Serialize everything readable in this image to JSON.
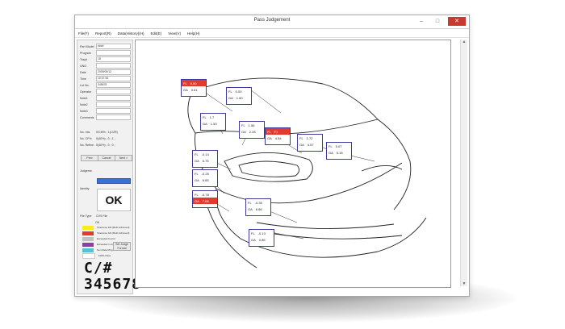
{
  "window": {
    "title": "Pass Judgement",
    "controls": {
      "minimize": "–",
      "maximize": "□",
      "close": "✕"
    }
  },
  "menu": [
    "File(F)",
    "Report(R)",
    "Data(History)(H)",
    "Edit(E)",
    "View(V)",
    "Help(H)"
  ],
  "fields": [
    {
      "label": "Part Model",
      "value": "####"
    },
    {
      "label": "Program",
      "value": ""
    },
    {
      "label": "Tray#",
      "value": "18"
    },
    {
      "label": "UNO",
      "value": ""
    },
    {
      "label": "Date",
      "value": "2009/05/12"
    },
    {
      "label": "Time",
      "value": "10:07:45"
    },
    {
      "label": "Lot No.",
      "value": "345678"
    },
    {
      "label": "Operator",
      "value": ""
    },
    {
      "label": "Note1",
      "value": ""
    },
    {
      "label": "Note2",
      "value": ""
    },
    {
      "label": "Note3",
      "value": ""
    },
    {
      "label": "Comments",
      "value": ""
    }
  ],
  "stats": [
    {
      "label": "No. mis.",
      "value": "0/CM% ; 1(L/2R)"
    },
    {
      "label": "No. CF%",
      "value": "0(40%) ; 0 ; 1 ;"
    },
    {
      "label": "No. Refine.",
      "value": "0(40%) ; 0 ; 0 ;"
    }
  ],
  "nav_buttons": {
    "prev": "Prev",
    "cancel": "Cancel",
    "next": "Next >"
  },
  "judgement": {
    "label": "Judgeme.",
    "identity_label": "Identity",
    "result": "OK"
  },
  "file_type": {
    "label": "File Type",
    "value": "CVS File"
  },
  "legend_title": "OK",
  "legend": [
    {
      "color": "#f6ee1a",
      "text": "Tolerance FAI (Both Achieved)"
    },
    {
      "color": "#e23b2e",
      "text": "Tolerance FAI (Both Achieved)"
    },
    {
      "color": "#c1c1c1",
      "text": "Exceeded 6 error"
    },
    {
      "color": "#8e3ea8",
      "text": "Exceeded 1 error"
    },
    {
      "color": "#55c2d6",
      "text": "Non Data Mtrg"
    },
    {
      "color": "#ffffff",
      "text": "100% Pass"
    }
  ],
  "legend_side": {
    "text": "Set Judge Format"
  },
  "code": {
    "line1": "C/#",
    "line2": "345678"
  },
  "labels": [
    {
      "k1": "FL",
      "v1": "0.00",
      "k2": "GA",
      "v2": "0.61",
      "red": true
    },
    {
      "k1": "FL",
      "v1": "0.00",
      "k2": "GA",
      "v2": "1.60",
      "red": false
    },
    {
      "k1": "FL",
      "v1": "1.7",
      "k2": "GA",
      "v2": "1.53",
      "red": false
    },
    {
      "k1": "FL",
      "v1": "1.56",
      "k2": "GA",
      "v2": "2.28",
      "red": false
    },
    {
      "k1": "FL",
      "v1": "F1",
      "k2": "GA",
      "v2": "4.54",
      "red": true
    },
    {
      "k1": "FL",
      "v1": "1.72",
      "k2": "GA",
      "v2": "4.57",
      "red": false
    },
    {
      "k1": "FL",
      "v1": "5.07",
      "k2": "GA",
      "v2": "5.18",
      "red": false
    },
    {
      "k1": "FL",
      "v1": "-0.14",
      "k2": "GA",
      "v2": "6.75",
      "red": false
    },
    {
      "k1": "FL",
      "v1": "-0.25",
      "k2": "GA",
      "v2": "6.65",
      "red": false
    },
    {
      "k1": "FL",
      "v1": "-0.78",
      "k2": "GA",
      "v2": "7.08",
      "red": true
    },
    {
      "k1": "FL",
      "v1": "-0.35",
      "k2": "GA",
      "v2": "6.66",
      "red": false
    },
    {
      "k1": "FL",
      "v1": "-0.13",
      "k2": "GA",
      "v2": "0.86",
      "red": false
    }
  ]
}
